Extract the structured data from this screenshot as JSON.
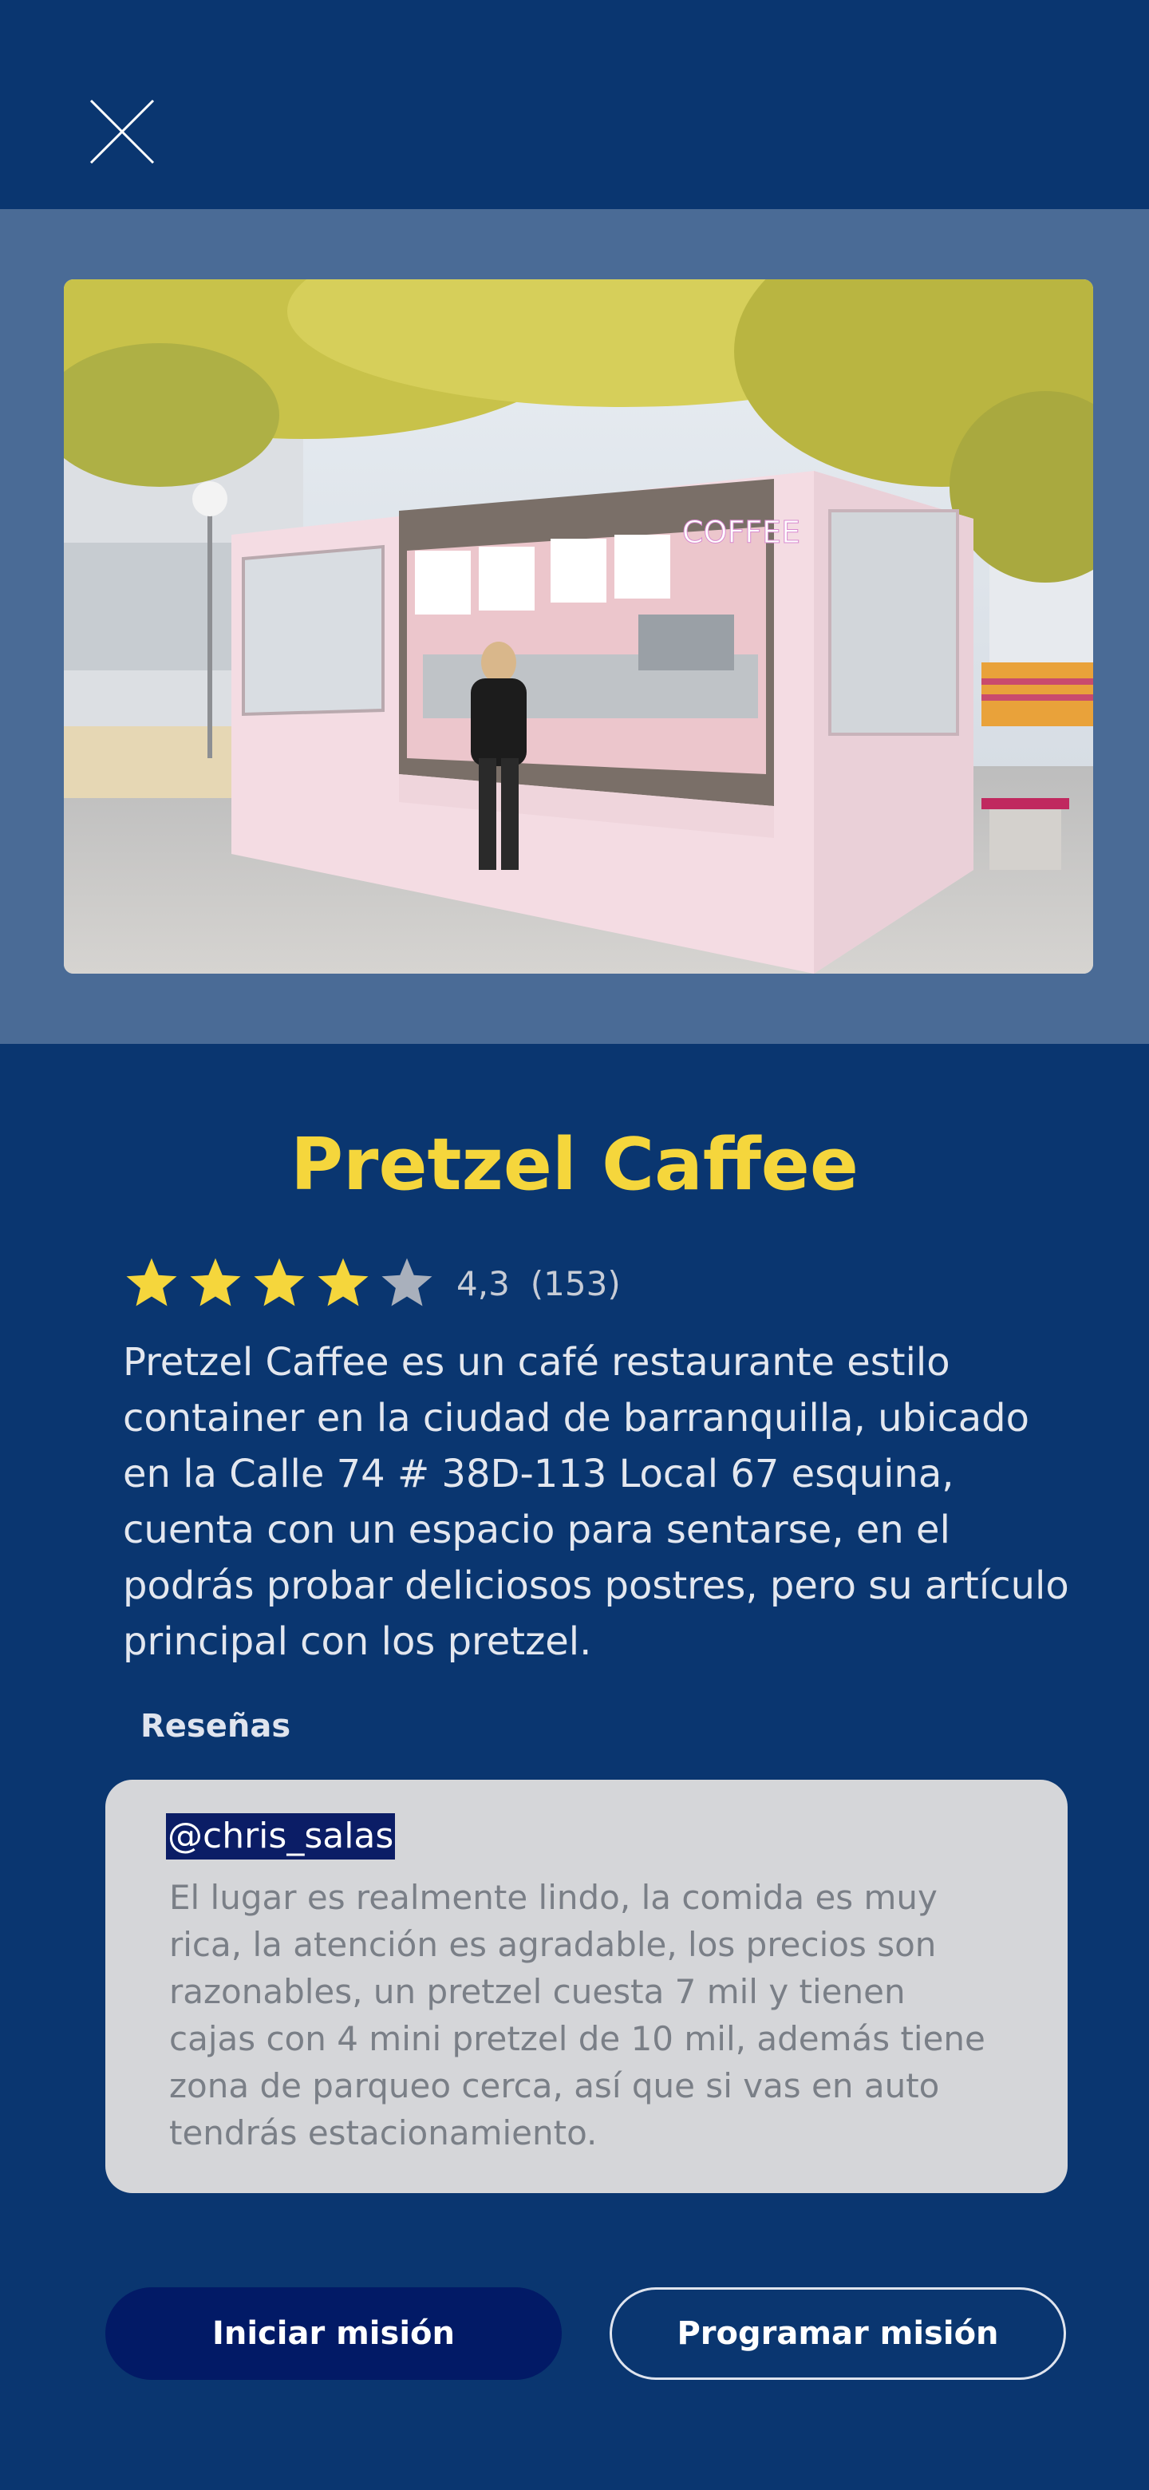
{
  "header": {
    "close_icon": "close-icon"
  },
  "hero": {
    "image_icon": "coffee-container-photo",
    "sign_text": "COFFEE"
  },
  "place": {
    "name": "Pretzel Caffee",
    "rating_value": "4,3",
    "rating_count": "(153)",
    "stars_filled": 4,
    "stars_total": 5,
    "description": "Pretzel Caffee es un café restaurante estilo container en la ciudad de barranquilla, ubicado en la  Calle 74 # 38D-113 Local 67 esquina, cuenta con un espacio para sentarse, en el podrás probar deliciosos postres, pero su artículo principal con los pretzel."
  },
  "reviews": {
    "label": "Reseñas",
    "items": [
      {
        "user": "@chris_salas",
        "text": "El lugar es realmente lindo, la comida es muy rica, la atención es agradable, los precios son razonables, un pretzel cuesta 7 mil y tienen cajas con 4 mini pretzel de 10 mil, además tiene zona de parqueo cerca, así que si vas en auto tendrás estacionamiento."
      }
    ]
  },
  "actions": {
    "start_label": "Iniciar misión",
    "schedule_label": "Programar misión"
  },
  "colors": {
    "background": "#0a3670",
    "hero_band": "#4a6b96",
    "title": "#f5d63c",
    "star_filled": "#f5d63c",
    "star_empty": "#a9b0bc",
    "card": "#d5d6d9",
    "primary_button": "#021a66"
  }
}
